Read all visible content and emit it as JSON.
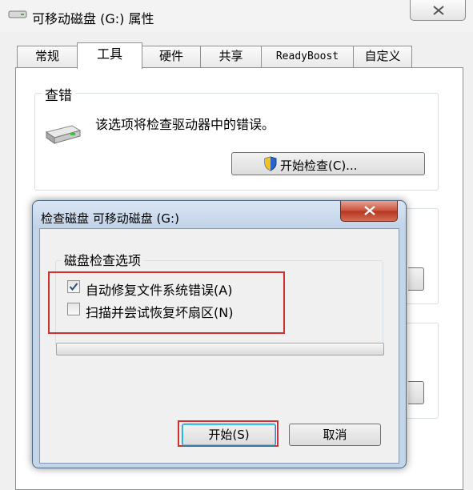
{
  "window": {
    "title": "可移动磁盘 (G:) 属性",
    "icon": "drive-icon",
    "close_icon": "close-icon"
  },
  "tabs": [
    {
      "label": "常规",
      "active": false
    },
    {
      "label": "工具",
      "active": true
    },
    {
      "label": "硬件",
      "active": false
    },
    {
      "label": "共享",
      "active": false
    },
    {
      "label": "ReadyBoost",
      "active": false
    },
    {
      "label": "自定义",
      "active": false
    }
  ],
  "check_section": {
    "title": "查错",
    "icon": "removable-drive-icon",
    "description": "该选项将检查驱动器中的错误。",
    "button_label": "开始检查(C)...",
    "button_icon": "uac-shield-icon"
  },
  "dialog": {
    "title": "检查磁盘 可移动磁盘 (G:)",
    "group_title": "磁盘检查选项",
    "options": [
      {
        "label": "自动修复文件系统错误(A)",
        "checked": true
      },
      {
        "label": "扫描并尝试恢复坏扇区(N)",
        "checked": false
      }
    ],
    "progress": 0,
    "start_label": "开始(S)",
    "cancel_label": "取消"
  },
  "colors": {
    "highlight": "#d32f2f",
    "dialog_frame": "#c4d5e8",
    "close_button": "#c7503a"
  }
}
